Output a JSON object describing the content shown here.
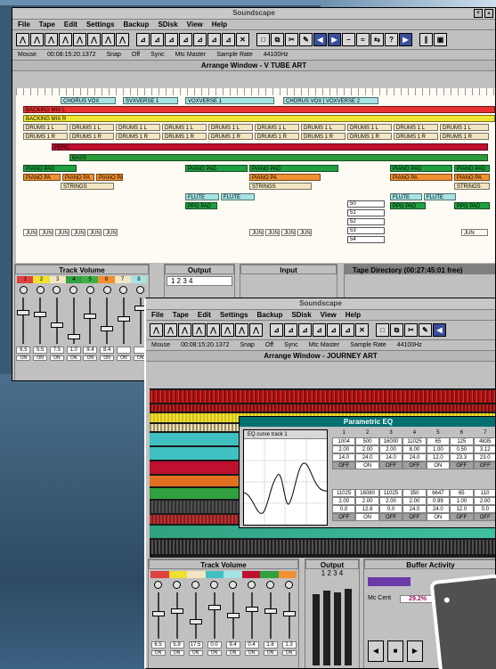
{
  "window1": {
    "title": "Soundscape",
    "menu": [
      "File",
      "Tape",
      "Edit",
      "Settings",
      "Backup",
      "SDisk",
      "View",
      "Help"
    ],
    "status": {
      "mouse_label": "Mouse",
      "mouse_value": "00:08:15:20.1372",
      "snap_label": "Snap",
      "snap_value": "Off",
      "sync_label": "Sync",
      "sync_value": "Mtc Master",
      "rate_label": "Sample Rate",
      "rate_value": "44100Hz"
    },
    "arrange_title": "Arrange Window - V  TUBE ART",
    "labels": [
      {
        "text": "CHORUS VOX",
        "color": "#a6e3e3"
      },
      {
        "text": "SVXVERSE 1",
        "color": "#a6e3e3"
      },
      {
        "text": "VOXVERSE 1",
        "color": "#a6e3e3"
      },
      {
        "text": "CHORUS VOX",
        "color": "#a6e3e3"
      },
      {
        "text": "VOXVERSE 2",
        "color": "#a6e3e3"
      }
    ],
    "tracks": [
      {
        "name": "BACKING MIX L",
        "color": "#e83232"
      },
      {
        "name": "BACKING MIX R",
        "color": "#f0e432"
      },
      {
        "name": "DRUMS 1 L",
        "color": "#f3e6c2"
      },
      {
        "name": "DRUMS 1 R",
        "color": "#f3e6c2"
      },
      {
        "name": "PERC",
        "color": "#c01030"
      },
      {
        "name": "BASS",
        "color": "#2c9a3a"
      },
      {
        "name": "PIANO PAD",
        "color": "#20a040"
      },
      {
        "name": "PIANO PA",
        "color": "#f09030"
      },
      {
        "name": "STRINGS",
        "color": "#f3e6c2"
      },
      {
        "name": "FLUTE",
        "color": "#a6e3e3"
      },
      {
        "name": "PPG PAD",
        "color": "#20a040"
      },
      {
        "name": "JUN",
        "color": "#fdfbf3"
      }
    ],
    "markers": [
      "50",
      "51",
      "52",
      "53",
      "54"
    ],
    "track_volume_title": "Track Volume",
    "output_title": "Output",
    "output_channels": "1 2 3 4",
    "input_title": "Input",
    "tape_dir_title": "Tape Directory (00:27:45:01 free)",
    "channel_numbers": [
      "1",
      "2",
      "3",
      "4",
      "5",
      "6",
      "7",
      "8"
    ],
    "fader_levels": [
      0.7,
      0.65,
      0.4,
      0.1,
      0.6,
      0.3,
      0.55,
      0.8
    ],
    "level_values": [
      "6.5",
      "5.5",
      "7.5",
      "1.0",
      "9.4",
      "8.4",
      "",
      ""
    ],
    "on_label": "ON"
  },
  "window2": {
    "title": "Soundscape",
    "menu": [
      "File",
      "Tape",
      "Edit",
      "Settings",
      "Backup",
      "SDisk",
      "View",
      "Help"
    ],
    "status": {
      "mouse_label": "Mouse",
      "mouse_value": "00:08:15:20.1372",
      "snap_label": "Snap",
      "snap_value": "Off",
      "sync_label": "Sync",
      "sync_value": "Mtc Master",
      "rate_label": "Sample Rate",
      "rate_value": "44100Hz"
    },
    "arrange_title": "Arrange Window - JOURNEY ART",
    "eq_title": "Parametric EQ",
    "eq_curve_title": "EQ curve track 1",
    "eq_headers": [
      "1",
      "2",
      "3",
      "4",
      "5",
      "6",
      "7"
    ],
    "eq_rows_top": [
      [
        "1004",
        "500",
        "16000",
        "11025",
        "65",
        "125",
        "4835"
      ],
      [
        "2.00",
        "2.00",
        "2.00",
        "8.00",
        "1.00",
        "0.50",
        "3.12"
      ],
      [
        "14.0",
        "24.0",
        "14.0",
        "24.0",
        "12.0",
        "23.3",
        "23.0"
      ]
    ],
    "eq_rows_bottom": [
      [
        "11025",
        "16080",
        "11025",
        "350",
        "6647",
        "65",
        "110"
      ],
      [
        "2.00",
        "2.00",
        "2.00",
        "2.00",
        "0.99",
        "1.00",
        "2.00"
      ],
      [
        "0.0",
        "12.8",
        "0.0",
        "24.0",
        "24.0",
        "12.0",
        "0.0"
      ]
    ],
    "eq_off": "OFF",
    "eq_on": "ON",
    "track_volume_title": "Track Volume",
    "output_title": "Output",
    "output_channels": "1 2 3 4",
    "buffer_title": "Buffer Activity",
    "cpu_label": "Mc Cent",
    "cpu_value": "29.2%",
    "fader_levels": [
      0.55,
      0.6,
      0.35,
      0.7,
      0.5,
      0.65,
      0.6,
      0.55
    ],
    "level_values": [
      "6.5",
      "5.9",
      "17.5",
      "0.0",
      "9.4",
      "0.4",
      "1.8",
      "1.3"
    ],
    "on_label": "ON"
  }
}
